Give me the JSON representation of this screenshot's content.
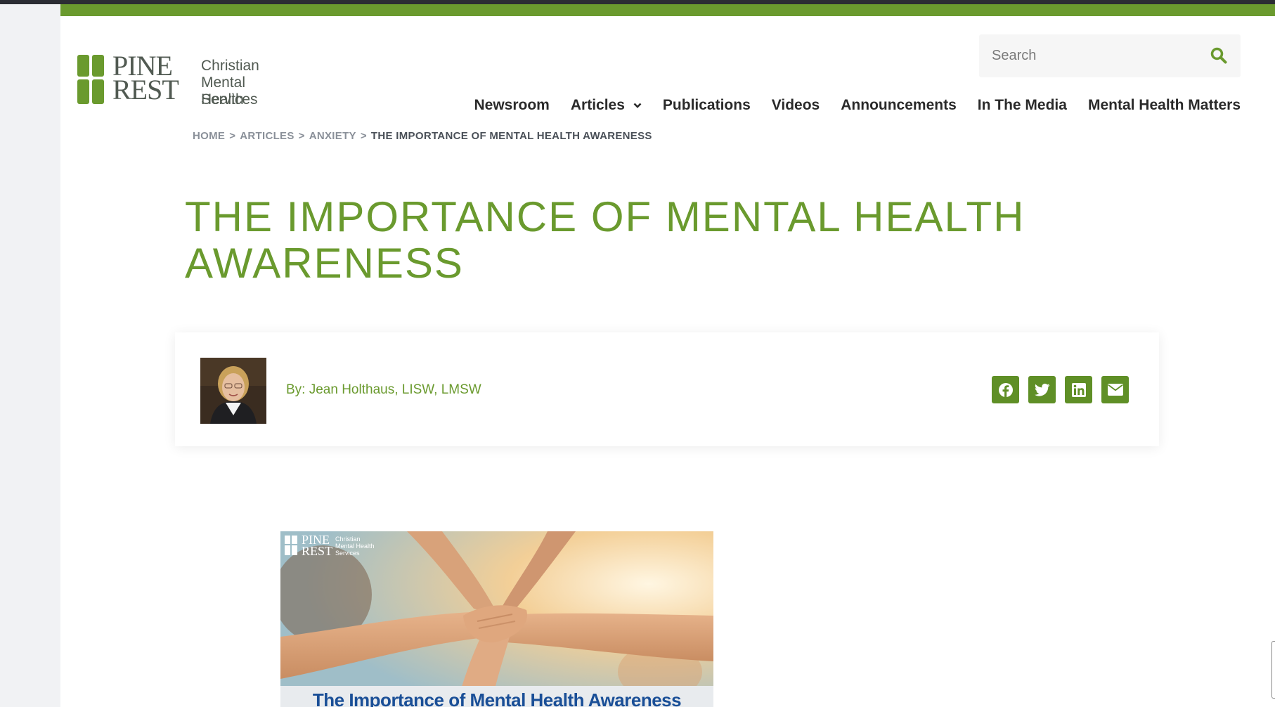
{
  "brand": {
    "word1": "PINE",
    "word2": "REST",
    "tagline": [
      "Christian",
      "Mental Health",
      "Services"
    ],
    "color": "#6a9a2e"
  },
  "search": {
    "placeholder": "Search",
    "icon": "search-icon"
  },
  "nav": {
    "items": [
      {
        "label": "Newsroom"
      },
      {
        "label": "Articles",
        "has_dropdown": true
      },
      {
        "label": "Publications"
      },
      {
        "label": "Videos"
      },
      {
        "label": "Announcements"
      },
      {
        "label": "In The Media"
      },
      {
        "label": "Mental Health Matters"
      }
    ]
  },
  "breadcrumb": {
    "items": [
      "HOME",
      "ARTICLES",
      "ANXIETY"
    ],
    "separator": ">",
    "current": "THE IMPORTANCE OF MENTAL HEALTH AWARENESS"
  },
  "article": {
    "title": "THE IMPORTANCE OF MENTAL HEALTH AWARENESS",
    "author": "By: Jean Holthaus, LISW, LMSW",
    "share": [
      "facebook-icon",
      "twitter-icon",
      "linkedin-icon",
      "email-icon"
    ],
    "image_caption": "The Importance of Mental Health Awareness",
    "image_logo": {
      "word1": "PINE",
      "word2": "REST",
      "tagline": [
        "Christian",
        "Mental Health",
        "Services"
      ]
    }
  },
  "colors": {
    "accent": "#6a9a2e",
    "share_bg": "#5f8f26",
    "caption": "#1a4f97"
  }
}
